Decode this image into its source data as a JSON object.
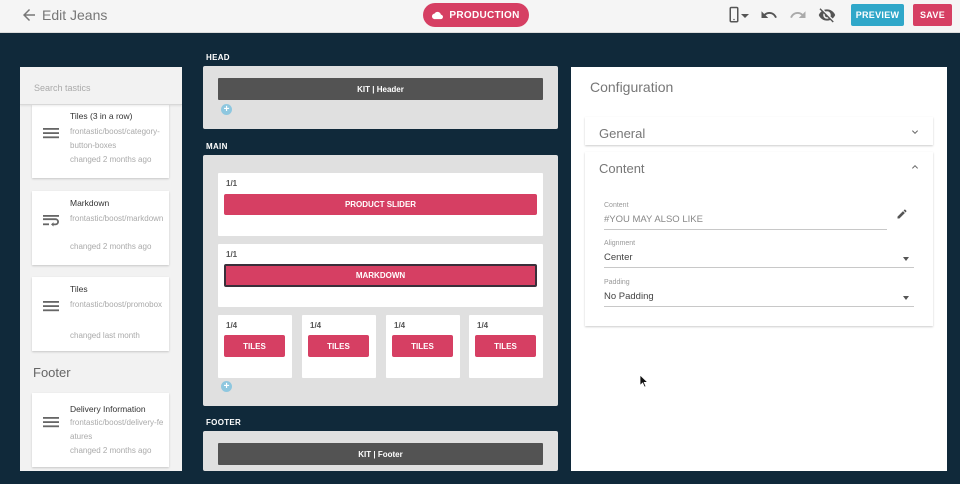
{
  "header": {
    "title": "Edit Jeans",
    "environment": "PRODUCTION",
    "preview_label": "PREVIEW",
    "save_label": "SAVE"
  },
  "sidebar": {
    "search_placeholder": "Search tastics",
    "items": [
      {
        "name": "Tiles (3 in a row)",
        "path": "frontastic/boost/category-button-boxes",
        "changed": "changed 2 months ago",
        "icon": "menu-icon"
      },
      {
        "name": "Markdown",
        "path": "frontastic/boost/markdown",
        "changed": "changed 2 months ago",
        "icon": "wrap-text-icon"
      },
      {
        "name": "Tiles",
        "path": "frontastic/boost/promobox",
        "changed": "changed last month",
        "icon": "menu-icon"
      }
    ],
    "footer_heading": "Footer",
    "footer_items": [
      {
        "name": "Delivery Information",
        "path": "frontastic/boost/delivery-features",
        "changed": "changed 2 months ago",
        "icon": "menu-icon"
      }
    ]
  },
  "layout": {
    "head": {
      "label": "HEAD",
      "kit": "KIT | Header"
    },
    "main": {
      "label": "MAIN",
      "rows": [
        {
          "width": "1/1",
          "tastic": "PRODUCT SLIDER"
        },
        {
          "width": "1/1",
          "tastic": "MARKDOWN"
        }
      ],
      "quarter": [
        {
          "width": "1/4",
          "tastic": "TILES"
        },
        {
          "width": "1/4",
          "tastic": "TILES"
        },
        {
          "width": "1/4",
          "tastic": "TILES"
        },
        {
          "width": "1/4",
          "tastic": "TILES"
        }
      ]
    },
    "footer": {
      "label": "FOOTER",
      "kit": "KIT | Footer"
    }
  },
  "config": {
    "title": "Configuration",
    "general_label": "General",
    "content_label": "Content",
    "fields": {
      "content": {
        "label": "Content",
        "value": "#YOU MAY ALSO LIKE"
      },
      "alignment": {
        "label": "Alignment",
        "value": "Center"
      },
      "padding": {
        "label": "Padding",
        "value": "No Padding"
      }
    }
  },
  "colors": {
    "background": "#10293a",
    "accent": "#d63f63",
    "preview": "#2fa7c9",
    "kit": "#535353"
  }
}
